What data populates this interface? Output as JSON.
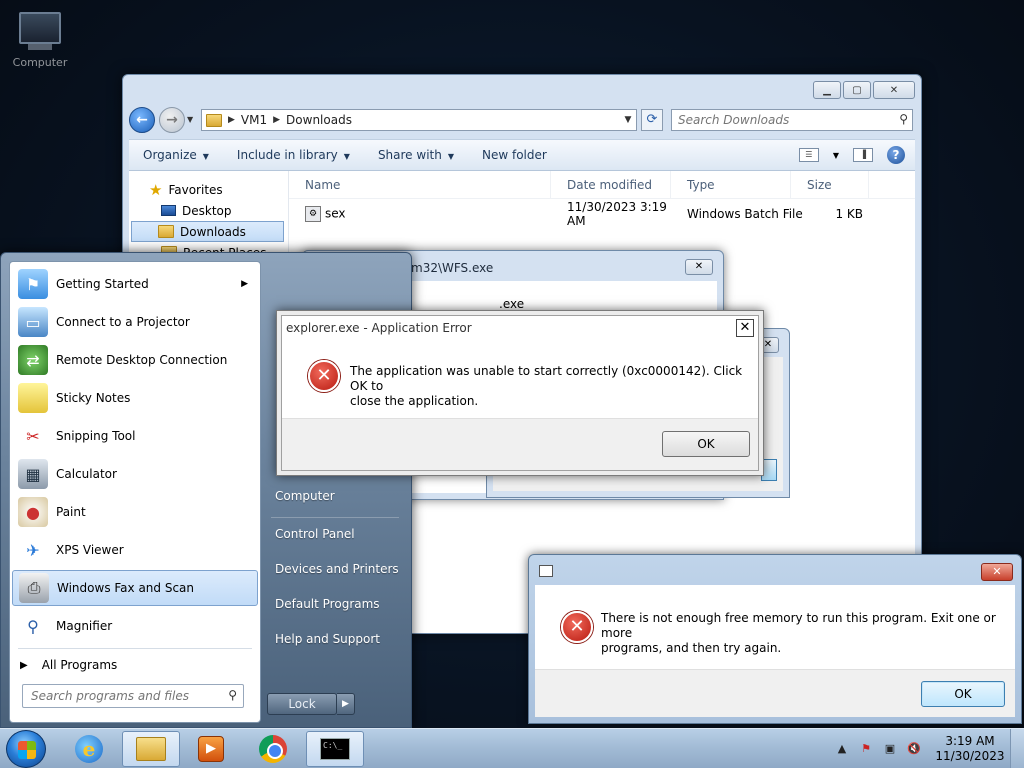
{
  "desktop": {
    "computer_label": "Computer"
  },
  "explorer": {
    "breadcrumb": [
      "VM1",
      "Downloads"
    ],
    "search_placeholder": "Search Downloads",
    "commands": [
      "Organize",
      "Include in library",
      "Share with",
      "New folder"
    ],
    "nav": {
      "favorites": "Favorites",
      "items": [
        "Desktop",
        "Downloads",
        "Recent Places"
      ]
    },
    "columns": [
      "Name",
      "Date modified",
      "Type",
      "Size"
    ],
    "files": [
      {
        "name": "sex",
        "date": "11/30/2023 3:19 AM",
        "type": "Windows Batch File",
        "size": "1 KB"
      }
    ]
  },
  "wfs_window": {
    "title": "m32\\WFS.exe",
    "body_text": ".exe"
  },
  "start_menu": {
    "programs": [
      "Getting Started",
      "Connect to a Projector",
      "Remote Desktop Connection",
      "Sticky Notes",
      "Snipping Tool",
      "Calculator",
      "Paint",
      "XPS Viewer",
      "Windows Fax and Scan",
      "Magnifier"
    ],
    "all_programs": "All Programs",
    "search_placeholder": "Search programs and files",
    "right_links": [
      "Computer",
      "Control Panel",
      "Devices and Printers",
      "Default Programs",
      "Help and Support"
    ],
    "lock_label": "Lock"
  },
  "app_error": {
    "title": "explorer.exe - Application Error",
    "message_line1": "The application was unable to start correctly (0xc0000142). Click OK to",
    "message_line2": "close the application.",
    "ok_label": "OK"
  },
  "memory_error": {
    "message_line1": "There is not enough free memory to run this program. Exit one or more",
    "message_line2": "programs, and then try again.",
    "ok_label": "OK"
  },
  "taskbar": {
    "clock_time": "3:19 AM",
    "clock_date": "11/30/2023",
    "cmd_glyph": "C:\\_"
  },
  "colors": {
    "error_red": "#c8261a",
    "highlight_blue": "#c1dbf7",
    "taskbar": "#a3bcd6"
  }
}
